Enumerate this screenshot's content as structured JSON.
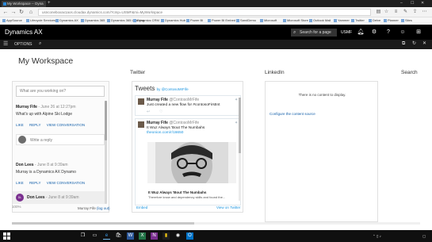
{
  "browser": {
    "tab_title": "My Workspace -- Dyna",
    "new_tab": "+",
    "window_controls": [
      "–",
      "☐",
      "✕"
    ],
    "url_prefix": "usnconeboxax1aos.cloudax.dynamics.com",
    "url_domain": "",
    "url_rest": "/?cmp=USMF&mi=MyWorkspace",
    "favorites": [
      "AppSource",
      "Lifecycle Services",
      "Dynamics AX",
      "Dynamics 365",
      "Dynamics 365 Learning",
      "Dynamics CRM",
      "Dynamics Hub",
      "Power BI",
      "Power BI Embed",
      "SandDemo",
      "Microsoft",
      "Microsoft Store",
      "Outlook Mail",
      "Yammer",
      "Twitter",
      "Delve",
      "Planner",
      "Sites"
    ]
  },
  "app": {
    "title": "Dynamics AX",
    "search_placeholder": "Search for a page",
    "company": "USMF",
    "options_label": "OPTIONS"
  },
  "workspace": {
    "title": "My Workspace",
    "zoom": "100%",
    "sections": {
      "twitter": "Twitter",
      "linkedin": "LinkedIn",
      "search": "Search"
    }
  },
  "chatter": {
    "placeholder": "What are you working on?",
    "posts": [
      {
        "author": "Murray Fife",
        "date": "- June 26 at 12:27pm",
        "text": "What's up with Alpine Ski Lodge",
        "like": "LIKE",
        "reply": "REPLY",
        "view": "VIEW CONVERSATION"
      },
      {
        "author": "Don Lees",
        "date": "- June 8 at 9:39am",
        "text": "Murray is a Dynamics AX Dynamo",
        "like": "LIKE",
        "reply": "REPLY",
        "view": "VIEW CONVERSATION"
      },
      {
        "author": "Don Lees",
        "date": "- June 8 at 9:39am",
        "text": "",
        "like": "",
        "reply": "",
        "view": ""
      }
    ],
    "reply_placeholder": "Write a reply",
    "footer_user": "Murray Fife",
    "footer_logout": "(log out)"
  },
  "twitter": {
    "header": "Tweets",
    "by": "by @ContosoMrFife",
    "tweet1": {
      "name": "Murray Fife",
      "handle": "@ContosoMrFife",
      "text": "Just created a new flow for #contosoFirstInt"
    },
    "tweet2": {
      "name": "Murray Fife",
      "handle": "@ContosoMrFife",
      "text": "It Wuz Always 'Bout The Numbahs",
      "link": "theonion.com/r/16650"
    },
    "caption_title": "It Wuz Always 'Bout The Numbahs",
    "caption_sub": "Therefore know and dependency skills and found the...",
    "embed": "Embed",
    "view_on": "View on Twitter"
  },
  "linkedin": {
    "empty": "There is no content to display.",
    "configure": "Configure the content source"
  },
  "colors": {
    "app_header": "#000000",
    "link": "#1460aa",
    "twitter_blue": "#1b95e0"
  }
}
